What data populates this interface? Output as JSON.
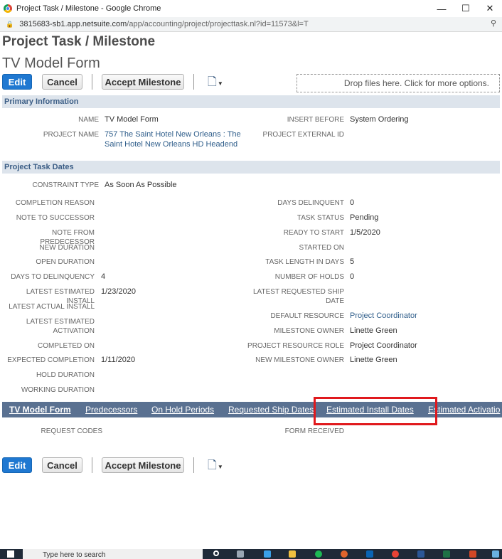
{
  "browser": {
    "window_title": "Project Task / Milestone - Google Chrome",
    "url_host": "3815683-sb1.app.netsuite.com",
    "url_path": "/app/accounting/project/projecttask.nl?id=11573&l=T",
    "controls": {
      "minimize": "—",
      "maximize": "☐",
      "close": "✕"
    }
  },
  "page": {
    "title": "Project Task / Milestone",
    "record_name": "TV Model Form"
  },
  "toolbar": {
    "edit": "Edit",
    "cancel": "Cancel",
    "accept": "Accept Milestone",
    "dropzone": "Drop files here. Click for more options."
  },
  "primary": {
    "header": "Primary Information",
    "name_label": "NAME",
    "name_value": "TV Model Form",
    "project_label": "PROJECT NAME",
    "project_value_1": "757 The Saint Hotel New Orleans : The",
    "project_value_2": "Saint Hotel New Orleans HD Headend",
    "insert_label": "INSERT BEFORE",
    "insert_value": "System Ordering",
    "ext_label": "PROJECT EXTERNAL ID"
  },
  "dates": {
    "header": "Project Task Dates",
    "constraint_label": "CONSTRAINT TYPE",
    "constraint_value": "As Soon As Possible",
    "left": [
      {
        "label": "COMPLETION REASON",
        "value": ""
      },
      {
        "label": "NOTE TO SUCCESSOR",
        "value": ""
      },
      {
        "label": "NOTE FROM PREDECESSOR",
        "value": ""
      },
      {
        "label": "NEW DURATION",
        "value": ""
      },
      {
        "label": "OPEN DURATION",
        "value": ""
      },
      {
        "label": "DAYS TO DELINQUENCY",
        "value": "4"
      },
      {
        "label": "LATEST ESTIMATED INSTALL",
        "value": "1/23/2020"
      },
      {
        "label": "LATEST ACTUAL INSTALL",
        "value": ""
      },
      {
        "label": "LATEST ESTIMATED",
        "label2": "ACTIVATION",
        "value": ""
      },
      {
        "label": "COMPLETED ON",
        "value": ""
      },
      {
        "label": "EXPECTED COMPLETION",
        "value": "1/11/2020"
      },
      {
        "label": "HOLD DURATION",
        "value": ""
      },
      {
        "label": "WORKING DURATION",
        "value": ""
      }
    ],
    "right": [
      {
        "label": "DAYS DELINQUENT",
        "value": "0"
      },
      {
        "label": "TASK STATUS",
        "value": "Pending"
      },
      {
        "label": "READY TO START",
        "value": "1/5/2020"
      },
      {
        "label": "STARTED ON",
        "value": ""
      },
      {
        "label": "TASK LENGTH IN DAYS",
        "value": "5"
      },
      {
        "label": "NUMBER OF HOLDS",
        "value": "0"
      },
      {
        "label": "LATEST REQUESTED SHIP",
        "label2": "DATE",
        "value": ""
      },
      {
        "label": "DEFAULT RESOURCE",
        "value": "Project Coordinator"
      },
      {
        "label": "MILESTONE OWNER",
        "value": "Linette Green"
      },
      {
        "label": "PROJECT RESOURCE ROLE",
        "value": "Project Coordinator"
      },
      {
        "label": "NEW MILESTONE OWNER",
        "value": "Linette Green"
      }
    ]
  },
  "subtabs": [
    "TV Model Form",
    "Predecessors",
    "On Hold Periods",
    "Requested Ship Dates",
    "Estimated Install Dates",
    "Estimated Activatio"
  ],
  "subtab_fields": {
    "request_codes": "REQUEST CODES",
    "form_received": "FORM RECEIVED"
  },
  "taskbar": {
    "search_placeholder": "Type here to search"
  },
  "colors": {
    "primary_button": "#1f78d1",
    "section_header_bg": "#dde4ec",
    "subtab_bar": "#5a7191",
    "highlight": "#e0191d"
  }
}
